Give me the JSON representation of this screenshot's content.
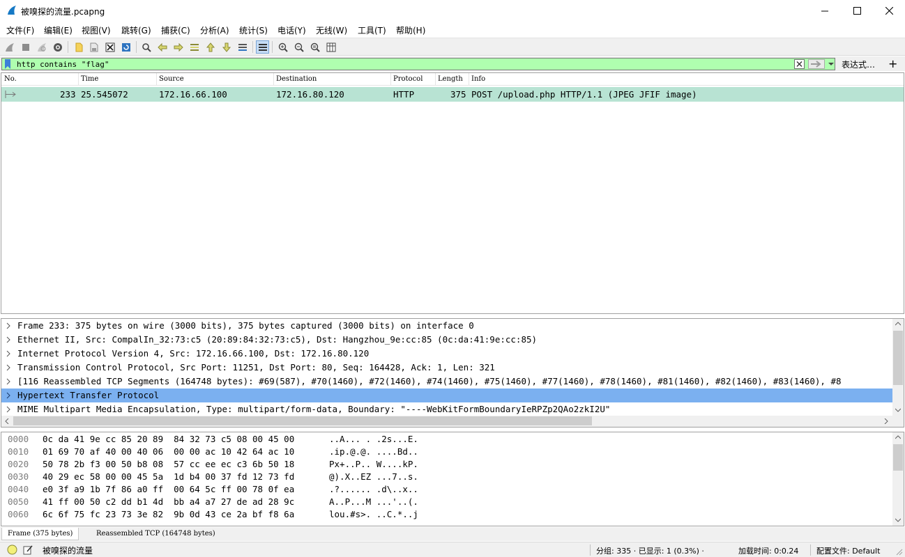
{
  "window": {
    "title": "被嗅探的流量.pcapng"
  },
  "menu": [
    "文件(F)",
    "编辑(E)",
    "视图(V)",
    "跳转(G)",
    "捕获(C)",
    "分析(A)",
    "统计(S)",
    "电话(Y)",
    "无线(W)",
    "工具(T)",
    "帮助(H)"
  ],
  "filter": {
    "value": "http contains \"flag\"",
    "expression_label": "表达式…",
    "add_label": "+"
  },
  "packet_list": {
    "columns": [
      "No.",
      "Time",
      "Source",
      "Destination",
      "Protocol",
      "Length",
      "Info"
    ],
    "rows": [
      {
        "no": "233",
        "time": "25.545072",
        "source": "172.16.66.100",
        "destination": "172.16.80.120",
        "protocol": "HTTP",
        "length": "375",
        "info": "POST /upload.php HTTP/1.1  (JPEG JFIF image)"
      }
    ],
    "row_color": "#b8e3d3"
  },
  "details": [
    "Frame 233: 375 bytes on wire (3000 bits), 375 bytes captured (3000 bits) on interface 0",
    "Ethernet II, Src: CompalIn_32:73:c5 (20:89:84:32:73:c5), Dst: Hangzhou_9e:cc:85 (0c:da:41:9e:cc:85)",
    "Internet Protocol Version 4, Src: 172.16.66.100, Dst: 172.16.80.120",
    "Transmission Control Protocol, Src Port: 11251, Dst Port: 80, Seq: 164428, Ack: 1, Len: 321",
    "[116 Reassembled TCP Segments (164748 bytes): #69(587), #70(1460), #72(1460), #74(1460), #75(1460), #77(1460), #78(1460), #81(1460), #82(1460), #83(1460), #8",
    "Hypertext Transfer Protocol",
    "MIME Multipart Media Encapsulation, Type: multipart/form-data, Boundary: \"----WebKitFormBoundaryIeRPZp2QAo2zkI2U\""
  ],
  "selected_detail": "Hypertext Transfer Protocol",
  "hex": [
    {
      "offset": "0000",
      "bytes": "0c da 41 9e cc 85 20 89  84 32 73 c5 08 00 45 00",
      "ascii": "..A... . .2s...E."
    },
    {
      "offset": "0010",
      "bytes": "01 69 70 af 40 00 40 06  00 00 ac 10 42 64 ac 10",
      "ascii": ".ip.@.@. ....Bd.."
    },
    {
      "offset": "0020",
      "bytes": "50 78 2b f3 00 50 b8 08  57 cc ee ec c3 6b 50 18",
      "ascii": "Px+..P.. W....kP."
    },
    {
      "offset": "0030",
      "bytes": "40 29 ec 58 00 00 45 5a  1d b4 00 37 fd 12 73 fd",
      "ascii": "@).X..EZ ...7..s."
    },
    {
      "offset": "0040",
      "bytes": "e0 3f a9 1b 7f 86 a0 ff  00 64 5c ff 00 78 0f ea",
      "ascii": ".?...... .d\\..x.."
    },
    {
      "offset": "0050",
      "bytes": "41 ff 00 50 c2 dd b1 4d  bb a4 a7 27 de ad 28 9c",
      "ascii": "A..P...M ...'..(."
    },
    {
      "offset": "0060",
      "bytes": "6c 6f 75 fc 23 73 3e 82  9b 0d 43 ce 2a bf f8 6a",
      "ascii": "lou.#s>. ..C.*..j"
    }
  ],
  "byte_tabs": [
    "Frame (375 bytes)",
    "Reassembled TCP (164748 bytes)"
  ],
  "status": {
    "file": "被嗅探的流量",
    "packets": "分组: 335 · 已显示: 1 (0.3%) ·",
    "load_time": "加载时间: 0:0.24",
    "profile": "配置文件: Default"
  },
  "colors": {
    "filter_valid": "#afffaf",
    "selected": "#7bb0f0"
  }
}
